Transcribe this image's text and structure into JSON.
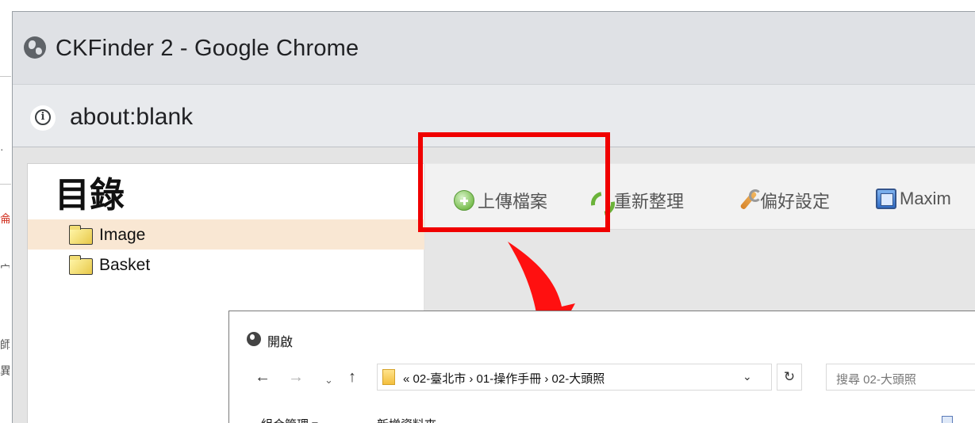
{
  "background": {
    "marks": [
      {
        "text": "·",
        "color": "#555555"
      },
      {
        "text": "侖",
        "color": "#d03020"
      },
      {
        "text": "宀",
        "color": "#555555"
      },
      {
        "text": "師",
        "color": "#555555"
      },
      {
        "text": "異",
        "color": "#555555"
      }
    ]
  },
  "window": {
    "title": "CKFinder 2 - Google Chrome",
    "icon": "globe-icon"
  },
  "address_bar": {
    "icon": "info-icon",
    "url": "about:blank"
  },
  "folders_panel": {
    "title": "目錄",
    "items": [
      {
        "label": "Image",
        "selected": true,
        "icon": "folder-icon"
      },
      {
        "label": "Basket",
        "selected": false,
        "icon": "folder-icon"
      }
    ]
  },
  "toolbar": {
    "items": [
      {
        "label": "上傳檔案",
        "icon": "upload-icon"
      },
      {
        "label": "重新整理",
        "icon": "refresh-icon"
      },
      {
        "label": "偏好設定",
        "icon": "settings-icon"
      },
      {
        "label": "Maxim",
        "icon": "maximize-icon"
      }
    ]
  },
  "annotation": {
    "highlight_color": "#f00000",
    "arrow_color": "#ff1010"
  },
  "open_dialog": {
    "title": "開啟",
    "icon": "globe-icon",
    "nav": {
      "back": "←",
      "forward": "→",
      "recent": "⌄",
      "up": "↑"
    },
    "path": "« 02-臺北市 › 01-操作手冊 › 02-大頭照",
    "path_dropdown": "⌄",
    "refresh": "↻",
    "search_placeholder": "搜尋 02-大頭照",
    "commands": [
      {
        "label": "組合管理 ▾"
      },
      {
        "label": "新增資料夾"
      }
    ]
  }
}
